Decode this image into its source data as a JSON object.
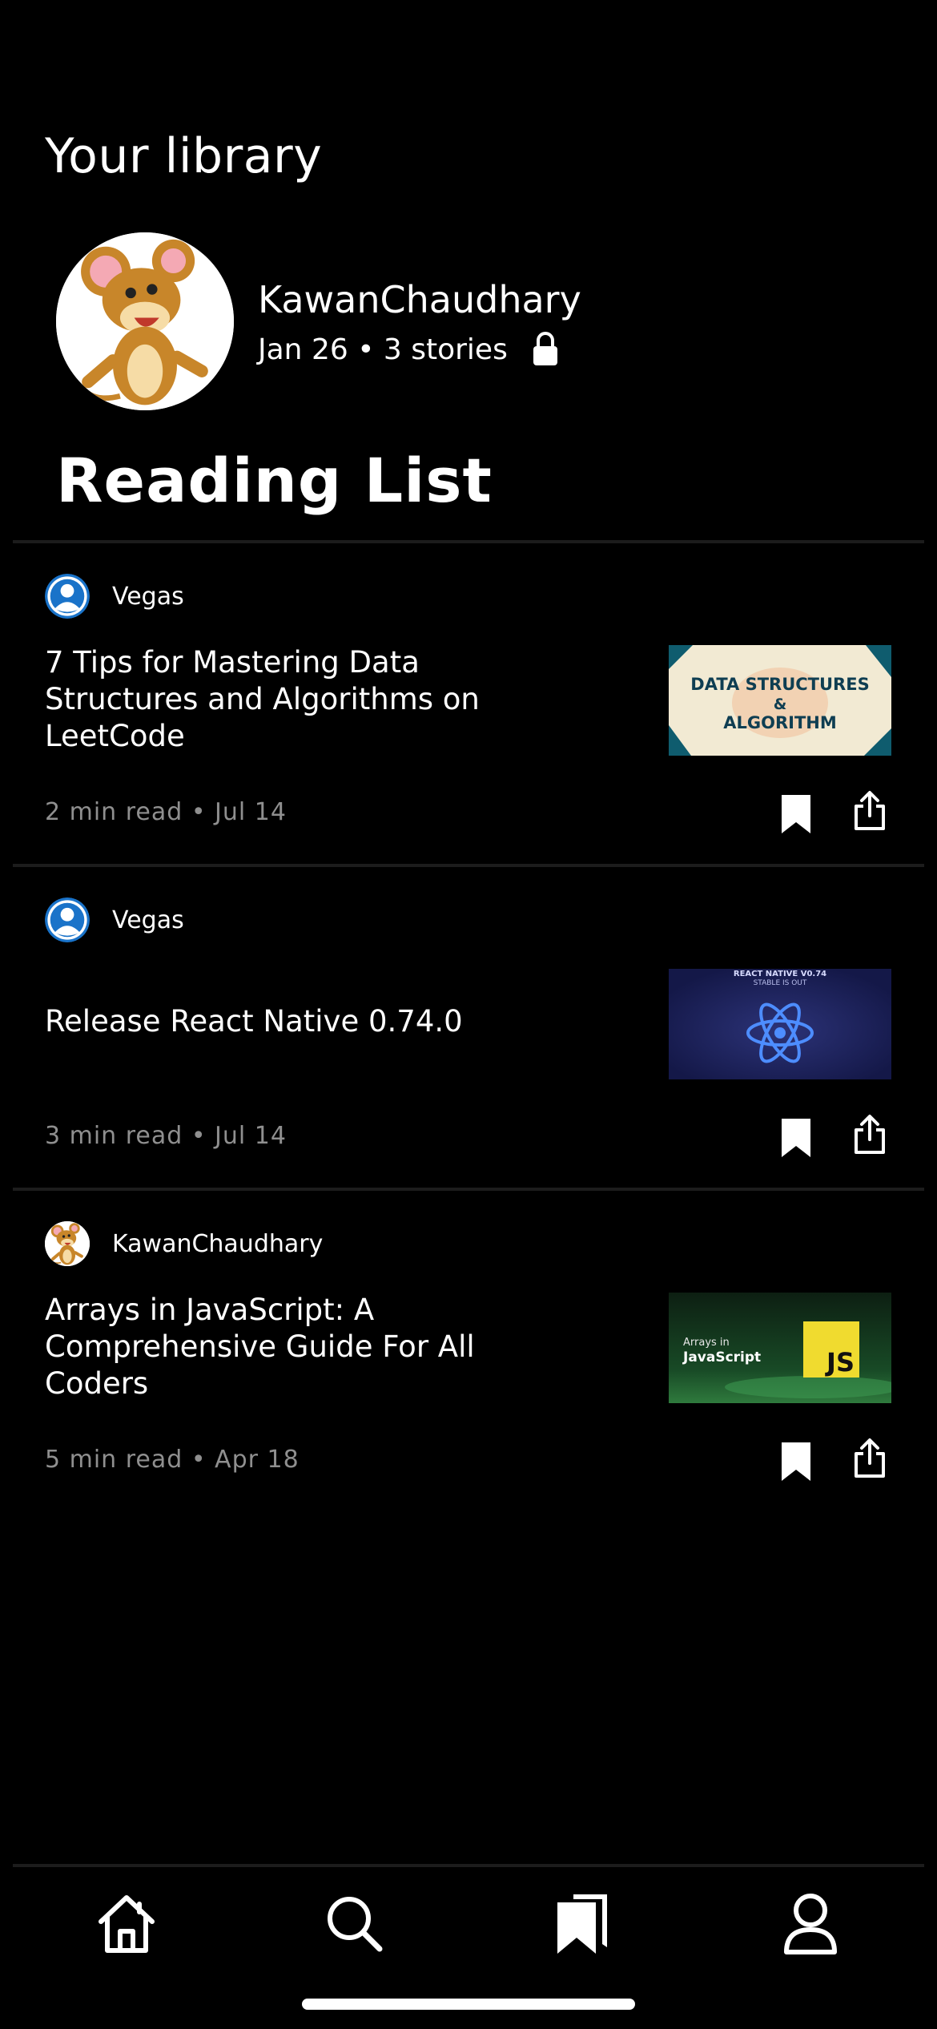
{
  "header": {
    "title": "Your library"
  },
  "profile": {
    "name": "KawanChaudhary",
    "meta": "Jan 26 • 3 stories",
    "avatar_icon": "jerry-mouse-avatar",
    "privacy_icon": "lock-icon"
  },
  "list": {
    "title": "Reading List"
  },
  "stories": [
    {
      "author": "Vegas",
      "author_avatar": "default-user-icon",
      "title": "7 Tips for Mastering Data Structures and Algorithms on LeetCode",
      "meta": "2 min read • Jul 14",
      "thumbnail": {
        "line1": "DATA STRUCTURES",
        "line2": "&",
        "line3": "ALGORITHM"
      }
    },
    {
      "author": "Vegas",
      "author_avatar": "default-user-icon",
      "title": "Release React Native 0.74.0",
      "meta": "3 min read • Jul 14",
      "thumbnail": {
        "line1": "REACT NATIVE V0.74",
        "line2": "STABLE IS OUT"
      }
    },
    {
      "author": "KawanChaudhary",
      "author_avatar": "jerry-mouse-avatar",
      "title": "Arrays in JavaScript: A Comprehensive Guide For All Coders",
      "meta": "5 min read • Apr 18",
      "thumbnail": {
        "line1": "Arrays in",
        "line2": "JavaScript",
        "badge": "JS"
      }
    }
  ],
  "tabbar": {
    "items": [
      "home-icon",
      "search-icon",
      "bookmarks-icon",
      "profile-icon"
    ],
    "active": "bookmarks-icon"
  },
  "colors": {
    "background": "#000000",
    "text": "#ffffff",
    "muted": "#8f8f8f",
    "author_avatar": "#1a73c9"
  }
}
